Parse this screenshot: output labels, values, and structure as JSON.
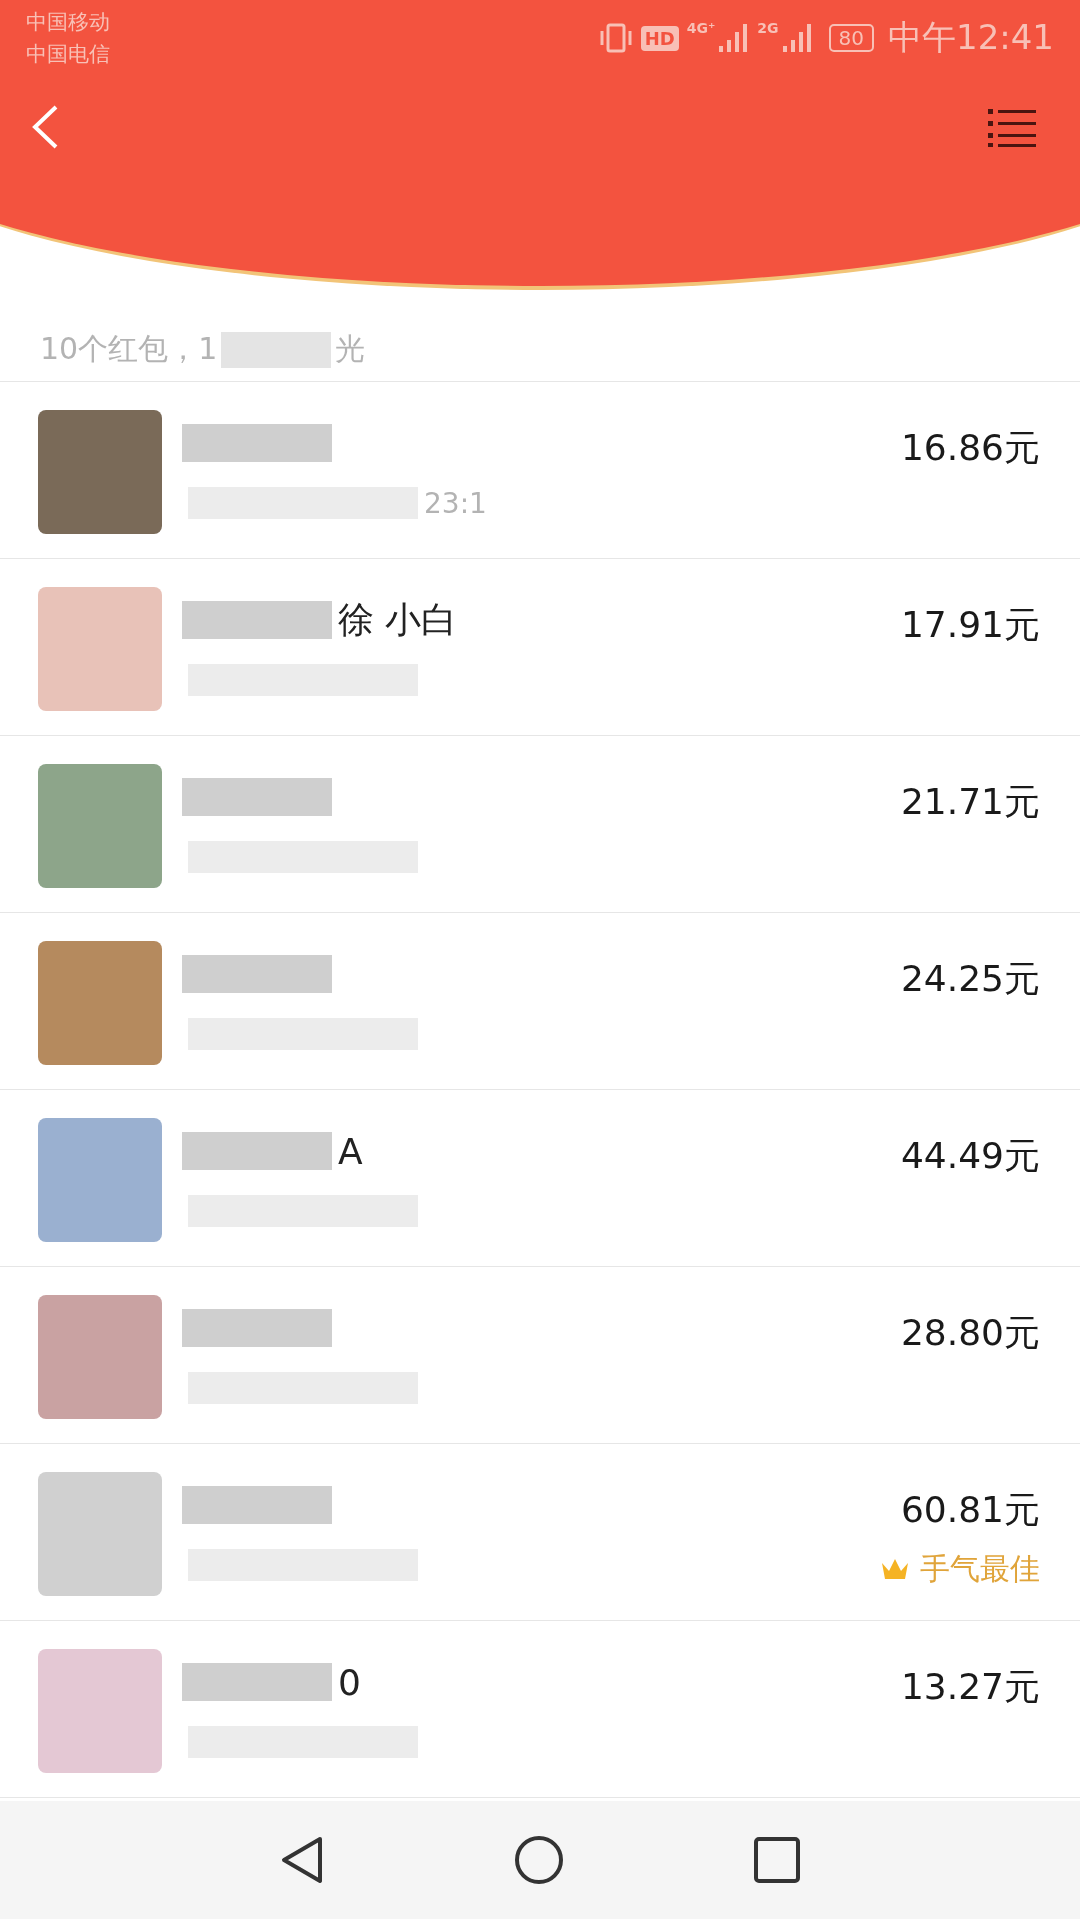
{
  "status_bar": {
    "carriers": [
      "中国移动",
      "中国电信"
    ],
    "hd": "HD",
    "network_1": "4G⁺",
    "network_2": "2G",
    "battery": "80",
    "time": "中午12:41"
  },
  "summary": {
    "before": "10个红包，1",
    "after": "光"
  },
  "rows": [
    {
      "amount": "16.86元",
      "time_fragment": "23:1",
      "best": false
    },
    {
      "amount": "17.91元",
      "name_fragment": "徐 小白",
      "best": false
    },
    {
      "amount": "21.71元",
      "best": false
    },
    {
      "amount": "24.25元",
      "best": false
    },
    {
      "amount": "44.49元",
      "name_fragment": "A",
      "best": false
    },
    {
      "amount": "28.80元",
      "best": false
    },
    {
      "amount": "60.81元",
      "best": true,
      "best_label": "手气最佳"
    },
    {
      "amount": "13.27元",
      "name_fragment": "0",
      "best": false
    }
  ]
}
